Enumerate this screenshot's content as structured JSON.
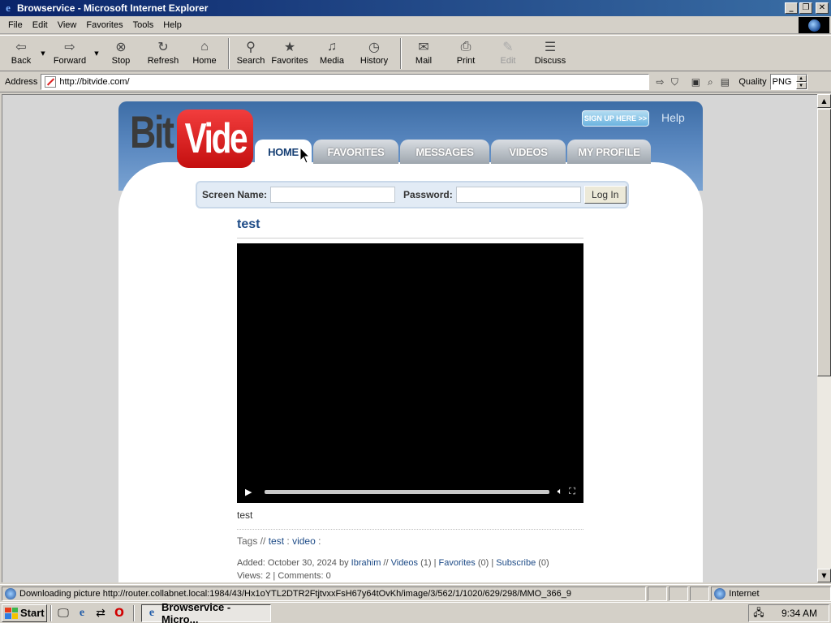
{
  "window": {
    "title": "Browservice - Microsoft Internet Explorer"
  },
  "menu": [
    "File",
    "Edit",
    "View",
    "Favorites",
    "Tools",
    "Help"
  ],
  "toolbar": {
    "back": "Back",
    "forward": "Forward",
    "stop": "Stop",
    "refresh": "Refresh",
    "home": "Home",
    "search": "Search",
    "favorites": "Favorites",
    "media": "Media",
    "history": "History",
    "mail": "Mail",
    "print": "Print",
    "edit": "Edit",
    "discuss": "Discuss"
  },
  "address": {
    "label": "Address",
    "url": "http://bitvide.com/",
    "quality_label": "Quality",
    "quality_value": "PNG"
  },
  "site": {
    "logo_left": "Bit",
    "logo_right": "Vide",
    "signup": "SIGN UP HERE >>",
    "help": "Help",
    "nav": [
      "HOME",
      "FAVORITES",
      "MESSAGES",
      "VIDEOS",
      "MY PROFILE"
    ],
    "login": {
      "screen_name_label": "Screen Name:",
      "password_label": "Password:",
      "button": "Log In"
    },
    "video": {
      "title": "test",
      "description": "test",
      "tags_label": "Tags //",
      "tags": [
        "test",
        "video"
      ],
      "added_prefix": "Added: October 30, 2024 by",
      "author": "Ibrahim",
      "sep1": "//",
      "videos_link": "Videos",
      "videos_count": "(1) |",
      "favorites_link": "Favorites",
      "favorites_count": "(0) |",
      "subscribe_link": "Subscribe",
      "subscribe_count": "(0)",
      "stats": "Views: 2 | Comments: 0",
      "progress": 0
    }
  },
  "status": {
    "text": "Downloading picture http://router.collabnet.local:1984/43/Hx1oYTL2DTR2FtjtvxxFsH67y64tOvKh/image/3/562/1/1020/629/298/MMO_366_9",
    "zone": "Internet"
  },
  "taskbar": {
    "start": "Start",
    "task": "Browservice - Micro...",
    "clock": "9:34 AM"
  }
}
